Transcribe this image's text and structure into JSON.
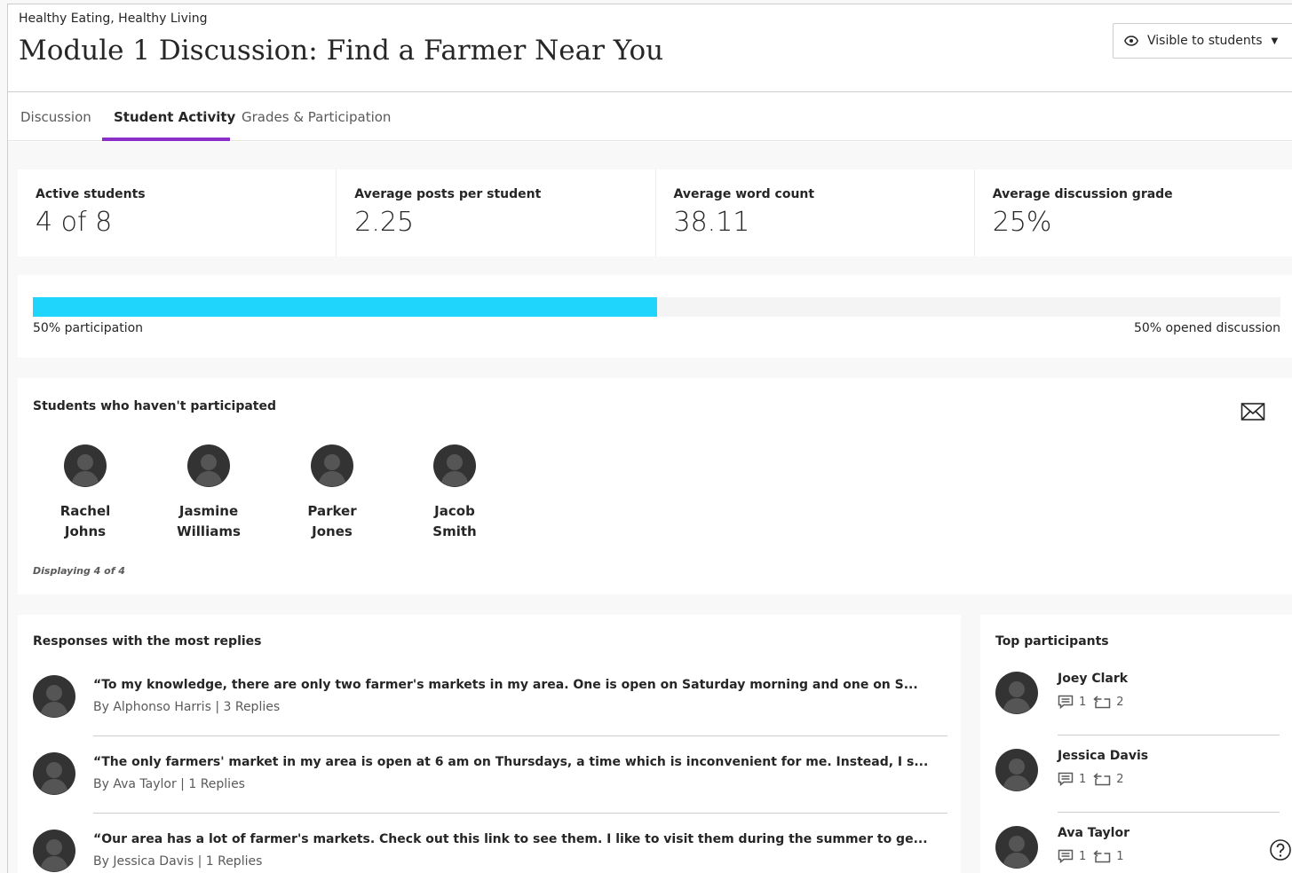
{
  "header": {
    "course": "Healthy Eating, Healthy Living",
    "title": "Module 1 Discussion: Find a Farmer Near You",
    "visibility": "Visible to students",
    "visibility_icon": "eye-icon"
  },
  "tabs": [
    {
      "label": "Discussion",
      "active": false
    },
    {
      "label": "Student Activity",
      "active": true
    },
    {
      "label": "Grades & Participation",
      "active": false
    }
  ],
  "stats": [
    {
      "label": "Active students",
      "value": "4 of 8"
    },
    {
      "label": "Average posts per student",
      "value": "2.25"
    },
    {
      "label": "Average word count",
      "value": "38.11"
    },
    {
      "label": "Average discussion grade",
      "value": "25%"
    }
  ],
  "participation": {
    "percent": 50,
    "left_label": "50% participation",
    "right_label": "50% opened discussion",
    "color": "#1fd5fb"
  },
  "not_participated": {
    "title": "Students who haven't participated",
    "mail_icon": "envelope-icon",
    "students": [
      {
        "first": "Rachel",
        "last": "Johns"
      },
      {
        "first": "Jasmine",
        "last": "Williams"
      },
      {
        "first": "Parker",
        "last": "Jones"
      },
      {
        "first": "Jacob",
        "last": "Smith"
      }
    ],
    "displaying": "Displaying 4 of 4"
  },
  "responses": {
    "title": "Responses with the most replies",
    "items": [
      {
        "quote": "“To my knowledge, there are only two farmer's markets in my area. One is open on Saturday morning and one on S...",
        "byline": "By Alphonso Harris | 3 Replies"
      },
      {
        "quote": "“The only farmers' market in my area is open at 6 am on Thursdays, a time which is inconvenient for me. Instead, I s...",
        "byline": "By Ava Taylor | 1 Replies"
      },
      {
        "quote": "“Our area has a lot of farmer's markets. Check out this link to see them. I like to visit them during the summer to ge...",
        "byline": "By Jessica Davis | 1 Replies"
      }
    ]
  },
  "top_participants": {
    "title": "Top participants",
    "items": [
      {
        "name": "Joey Clark",
        "posts": "1",
        "replies": "2"
      },
      {
        "name": "Jessica Davis",
        "posts": "1",
        "replies": "2"
      },
      {
        "name": "Ava Taylor",
        "posts": "1",
        "replies": "1"
      }
    ]
  },
  "accent_color": "#8b2fc9",
  "help_icon": "help-icon"
}
